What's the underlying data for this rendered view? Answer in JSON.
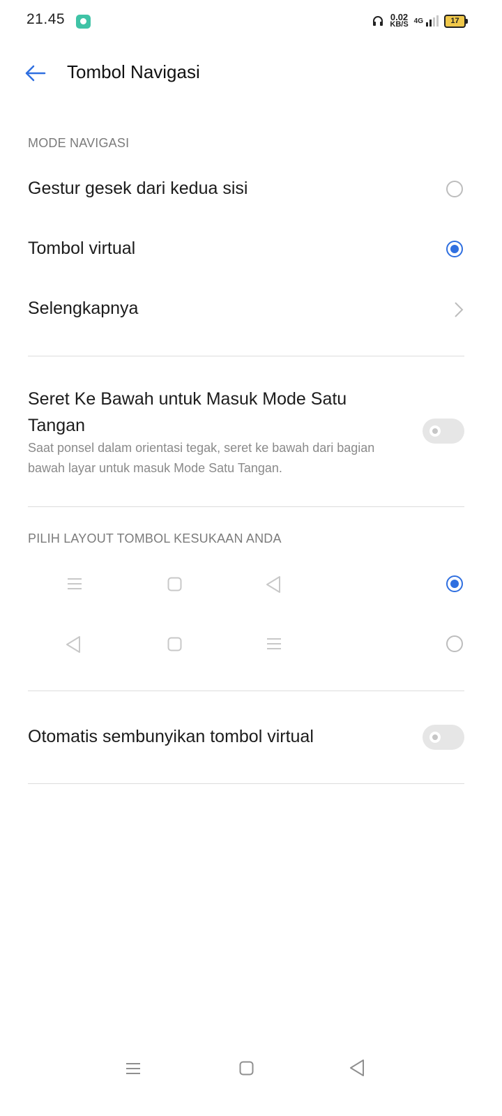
{
  "status_bar": {
    "time": "21.45",
    "speed_value": "0.02",
    "speed_unit": "KB/S",
    "network": "4G",
    "battery": "17"
  },
  "header": {
    "title": "Tombol Navigasi"
  },
  "mode_section": {
    "heading": "MODE NAVIGASI",
    "options": [
      {
        "label": "Gestur gesek dari kedua sisi",
        "selected": false
      },
      {
        "label": "Tombol virtual",
        "selected": true
      }
    ],
    "more_label": "Selengkapnya"
  },
  "one_hand": {
    "title": "Seret Ke Bawah untuk Masuk Mode Satu Tangan",
    "description": "Saat ponsel dalam orientasi tegak, seret ke bawah dari bagian bawah layar untuk masuk Mode Satu Tangan.",
    "enabled": false
  },
  "layout_section": {
    "heading": "PILIH LAYOUT TOMBOL KESUKAAN ANDA",
    "layouts": [
      {
        "icons": [
          "menu-icon",
          "home-square-icon",
          "back-triangle-icon"
        ],
        "selected": true
      },
      {
        "icons": [
          "back-triangle-icon",
          "home-square-icon",
          "menu-icon"
        ],
        "selected": false
      }
    ]
  },
  "auto_hide": {
    "label": "Otomatis sembunyikan tombol virtual",
    "enabled": false
  },
  "colors": {
    "accent": "#2f6fe0",
    "divider": "#dcdcdc"
  }
}
